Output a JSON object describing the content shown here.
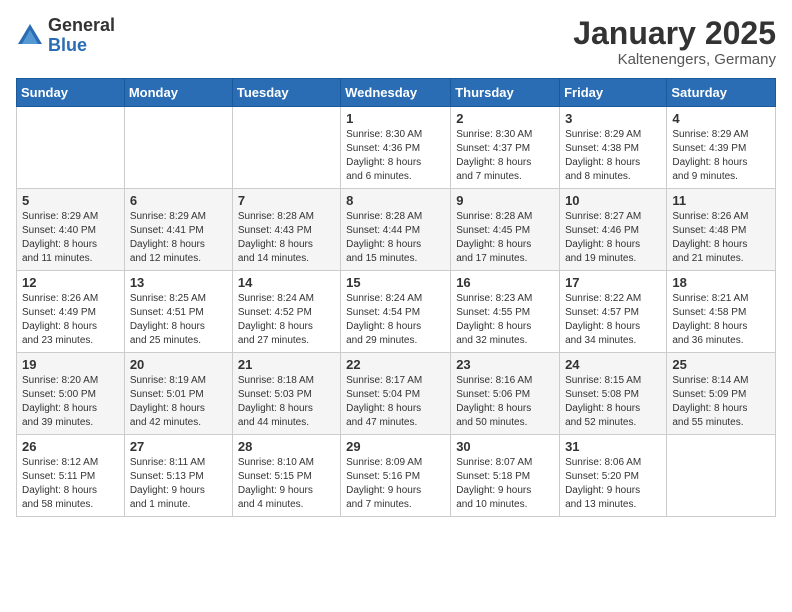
{
  "header": {
    "logo_general": "General",
    "logo_blue": "Blue",
    "month_title": "January 2025",
    "location": "Kaltenengers, Germany"
  },
  "days_of_week": [
    "Sunday",
    "Monday",
    "Tuesday",
    "Wednesday",
    "Thursday",
    "Friday",
    "Saturday"
  ],
  "weeks": [
    [
      {
        "day": "",
        "info": ""
      },
      {
        "day": "",
        "info": ""
      },
      {
        "day": "",
        "info": ""
      },
      {
        "day": "1",
        "info": "Sunrise: 8:30 AM\nSunset: 4:36 PM\nDaylight: 8 hours\nand 6 minutes."
      },
      {
        "day": "2",
        "info": "Sunrise: 8:30 AM\nSunset: 4:37 PM\nDaylight: 8 hours\nand 7 minutes."
      },
      {
        "day": "3",
        "info": "Sunrise: 8:29 AM\nSunset: 4:38 PM\nDaylight: 8 hours\nand 8 minutes."
      },
      {
        "day": "4",
        "info": "Sunrise: 8:29 AM\nSunset: 4:39 PM\nDaylight: 8 hours\nand 9 minutes."
      }
    ],
    [
      {
        "day": "5",
        "info": "Sunrise: 8:29 AM\nSunset: 4:40 PM\nDaylight: 8 hours\nand 11 minutes."
      },
      {
        "day": "6",
        "info": "Sunrise: 8:29 AM\nSunset: 4:41 PM\nDaylight: 8 hours\nand 12 minutes."
      },
      {
        "day": "7",
        "info": "Sunrise: 8:28 AM\nSunset: 4:43 PM\nDaylight: 8 hours\nand 14 minutes."
      },
      {
        "day": "8",
        "info": "Sunrise: 8:28 AM\nSunset: 4:44 PM\nDaylight: 8 hours\nand 15 minutes."
      },
      {
        "day": "9",
        "info": "Sunrise: 8:28 AM\nSunset: 4:45 PM\nDaylight: 8 hours\nand 17 minutes."
      },
      {
        "day": "10",
        "info": "Sunrise: 8:27 AM\nSunset: 4:46 PM\nDaylight: 8 hours\nand 19 minutes."
      },
      {
        "day": "11",
        "info": "Sunrise: 8:26 AM\nSunset: 4:48 PM\nDaylight: 8 hours\nand 21 minutes."
      }
    ],
    [
      {
        "day": "12",
        "info": "Sunrise: 8:26 AM\nSunset: 4:49 PM\nDaylight: 8 hours\nand 23 minutes."
      },
      {
        "day": "13",
        "info": "Sunrise: 8:25 AM\nSunset: 4:51 PM\nDaylight: 8 hours\nand 25 minutes."
      },
      {
        "day": "14",
        "info": "Sunrise: 8:24 AM\nSunset: 4:52 PM\nDaylight: 8 hours\nand 27 minutes."
      },
      {
        "day": "15",
        "info": "Sunrise: 8:24 AM\nSunset: 4:54 PM\nDaylight: 8 hours\nand 29 minutes."
      },
      {
        "day": "16",
        "info": "Sunrise: 8:23 AM\nSunset: 4:55 PM\nDaylight: 8 hours\nand 32 minutes."
      },
      {
        "day": "17",
        "info": "Sunrise: 8:22 AM\nSunset: 4:57 PM\nDaylight: 8 hours\nand 34 minutes."
      },
      {
        "day": "18",
        "info": "Sunrise: 8:21 AM\nSunset: 4:58 PM\nDaylight: 8 hours\nand 36 minutes."
      }
    ],
    [
      {
        "day": "19",
        "info": "Sunrise: 8:20 AM\nSunset: 5:00 PM\nDaylight: 8 hours\nand 39 minutes."
      },
      {
        "day": "20",
        "info": "Sunrise: 8:19 AM\nSunset: 5:01 PM\nDaylight: 8 hours\nand 42 minutes."
      },
      {
        "day": "21",
        "info": "Sunrise: 8:18 AM\nSunset: 5:03 PM\nDaylight: 8 hours\nand 44 minutes."
      },
      {
        "day": "22",
        "info": "Sunrise: 8:17 AM\nSunset: 5:04 PM\nDaylight: 8 hours\nand 47 minutes."
      },
      {
        "day": "23",
        "info": "Sunrise: 8:16 AM\nSunset: 5:06 PM\nDaylight: 8 hours\nand 50 minutes."
      },
      {
        "day": "24",
        "info": "Sunrise: 8:15 AM\nSunset: 5:08 PM\nDaylight: 8 hours\nand 52 minutes."
      },
      {
        "day": "25",
        "info": "Sunrise: 8:14 AM\nSunset: 5:09 PM\nDaylight: 8 hours\nand 55 minutes."
      }
    ],
    [
      {
        "day": "26",
        "info": "Sunrise: 8:12 AM\nSunset: 5:11 PM\nDaylight: 8 hours\nand 58 minutes."
      },
      {
        "day": "27",
        "info": "Sunrise: 8:11 AM\nSunset: 5:13 PM\nDaylight: 9 hours\nand 1 minute."
      },
      {
        "day": "28",
        "info": "Sunrise: 8:10 AM\nSunset: 5:15 PM\nDaylight: 9 hours\nand 4 minutes."
      },
      {
        "day": "29",
        "info": "Sunrise: 8:09 AM\nSunset: 5:16 PM\nDaylight: 9 hours\nand 7 minutes."
      },
      {
        "day": "30",
        "info": "Sunrise: 8:07 AM\nSunset: 5:18 PM\nDaylight: 9 hours\nand 10 minutes."
      },
      {
        "day": "31",
        "info": "Sunrise: 8:06 AM\nSunset: 5:20 PM\nDaylight: 9 hours\nand 13 minutes."
      },
      {
        "day": "",
        "info": ""
      }
    ]
  ]
}
